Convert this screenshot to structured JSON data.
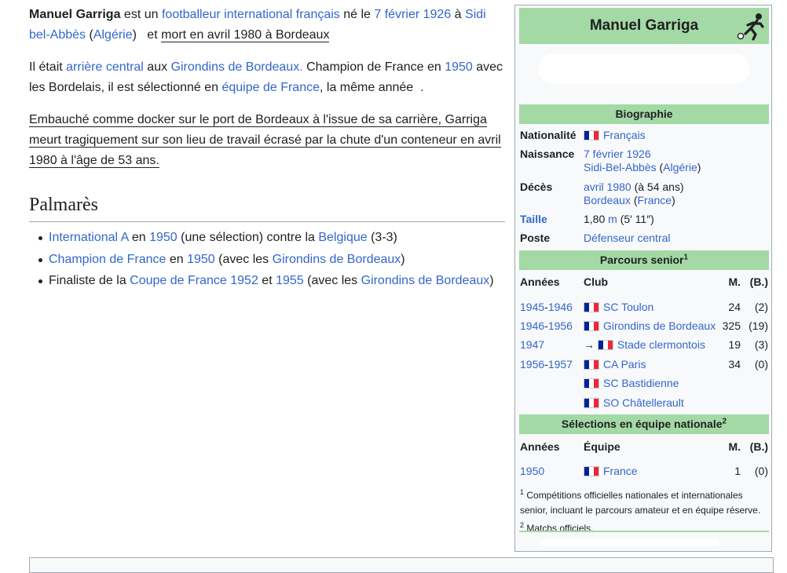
{
  "article": {
    "p1": {
      "name": "Manuel Garriga",
      "t1": " est un ",
      "l_footballeur": "footballeur",
      "sp1": " ",
      "l_international": "international",
      "sp2": " ",
      "l_francais": "français",
      "t2": " né le ",
      "l_date": "7 février 1926",
      "t3": " à ",
      "l_sidi": "Sidi bel-Abbès",
      "t4": " (",
      "l_algerie": "Algérie",
      "t5": ")   et ",
      "mort": "mort en avril 1980 à Bordeaux"
    },
    "p2": {
      "t1": "Il était ",
      "l_arriere": "arrière central",
      "t2": " aux ",
      "l_girondins": "Girondins de Bordeaux.",
      "t3": " Champion de France en ",
      "l_1950": "1950",
      "t4": " avec les Bordelais, il est sélectionné en ",
      "l_equipe": "équipe de France",
      "t5": ", la même année  ."
    },
    "p3": "Embauché comme docker sur le port de Bordeaux à l'issue de sa carrière, Garriga meurt tragiquement sur son lieu de travail écrasé par la chute d'un conteneur en avril 1980 à l'âge de 53 ans.",
    "palmares_heading": "Palmarès",
    "palmares": [
      {
        "a": "International A",
        "b": " en ",
        "c": "1950",
        "d": " (une sélection) contre la ",
        "e": "Belgique",
        "f": " (3-3)"
      },
      {
        "a": "Champion de France",
        "b": " en ",
        "c": "1950",
        "d": " (avec les ",
        "e": "Girondins de Bordeaux",
        "f": ")"
      },
      {
        "pre": "Finaliste de la ",
        "a": "Coupe de France 1952",
        "b": " et ",
        "c": "1955",
        "d": " (avec les ",
        "e": "Girondins de Bordeaux",
        "f": ")"
      }
    ]
  },
  "infobox": {
    "title": "Manuel Garriga",
    "sections": {
      "bio": "Biographie",
      "senior": "Parcours senior",
      "senior_sup": "1",
      "national": "Sélections en équipe nationale",
      "national_sup": "2"
    },
    "bio": {
      "nat_label": "Nationalité",
      "nat_value": "Français",
      "birth_label": "Naissance",
      "birth_date": "7 février 1926",
      "birth_city": "Sidi-Bel-Abbès",
      "birth_country": "Algérie",
      "death_label": "Décès",
      "death_date": "avril 1980",
      "death_age": " (à 54 ans)",
      "death_city": "Bordeaux",
      "death_country": "France",
      "height_label": "Taille",
      "height_num": "1,80",
      "height_unit": "m",
      "height_ft": " (5′ 11″)",
      "pos_label": "Poste",
      "pos_value": "Défenseur central"
    },
    "columns": {
      "years": "Années",
      "club": "Club",
      "team": "Équipe",
      "m": "M.",
      "b": "(B.)"
    },
    "clubs": [
      {
        "y1": "1945",
        "y2": "1946",
        "club": "SC Toulon",
        "m": "24",
        "b": "(2)",
        "loan": false
      },
      {
        "y1": "1946",
        "y2": "1956",
        "club": "Girondins de Bordeaux",
        "m": "325",
        "b": "(19)",
        "loan": false
      },
      {
        "y1": "1947",
        "y2": "",
        "club": "Stade clermontois",
        "m": "19",
        "b": "(3)",
        "loan": true
      },
      {
        "y1": "1956",
        "y2": "1957",
        "club": "CA Paris",
        "m": "34",
        "b": "(0)",
        "loan": false
      },
      {
        "y1": "",
        "y2": "",
        "club": "SC Bastidienne",
        "m": "",
        "b": "",
        "loan": false
      },
      {
        "y1": "",
        "y2": "",
        "club": "SO Châtellerault",
        "m": "",
        "b": "",
        "loan": false
      }
    ],
    "loan_arrow": "→ ",
    "national": [
      {
        "y": "1950",
        "team": "France",
        "m": "1",
        "b": "(0)"
      }
    ],
    "notes": {
      "n1_sup": "1",
      "n1": " Compétitions officielles nationales et internationales senior, incluant le parcours amateur et en équipe réserve.",
      "n2_sup": "2",
      "n2": " Matchs officiels."
    }
  },
  "colors": {
    "link": "#3366cc",
    "section_bg": "#a3d9a5",
    "infobox_bg": "#f8f9fa",
    "border": "#a2a9b1"
  }
}
